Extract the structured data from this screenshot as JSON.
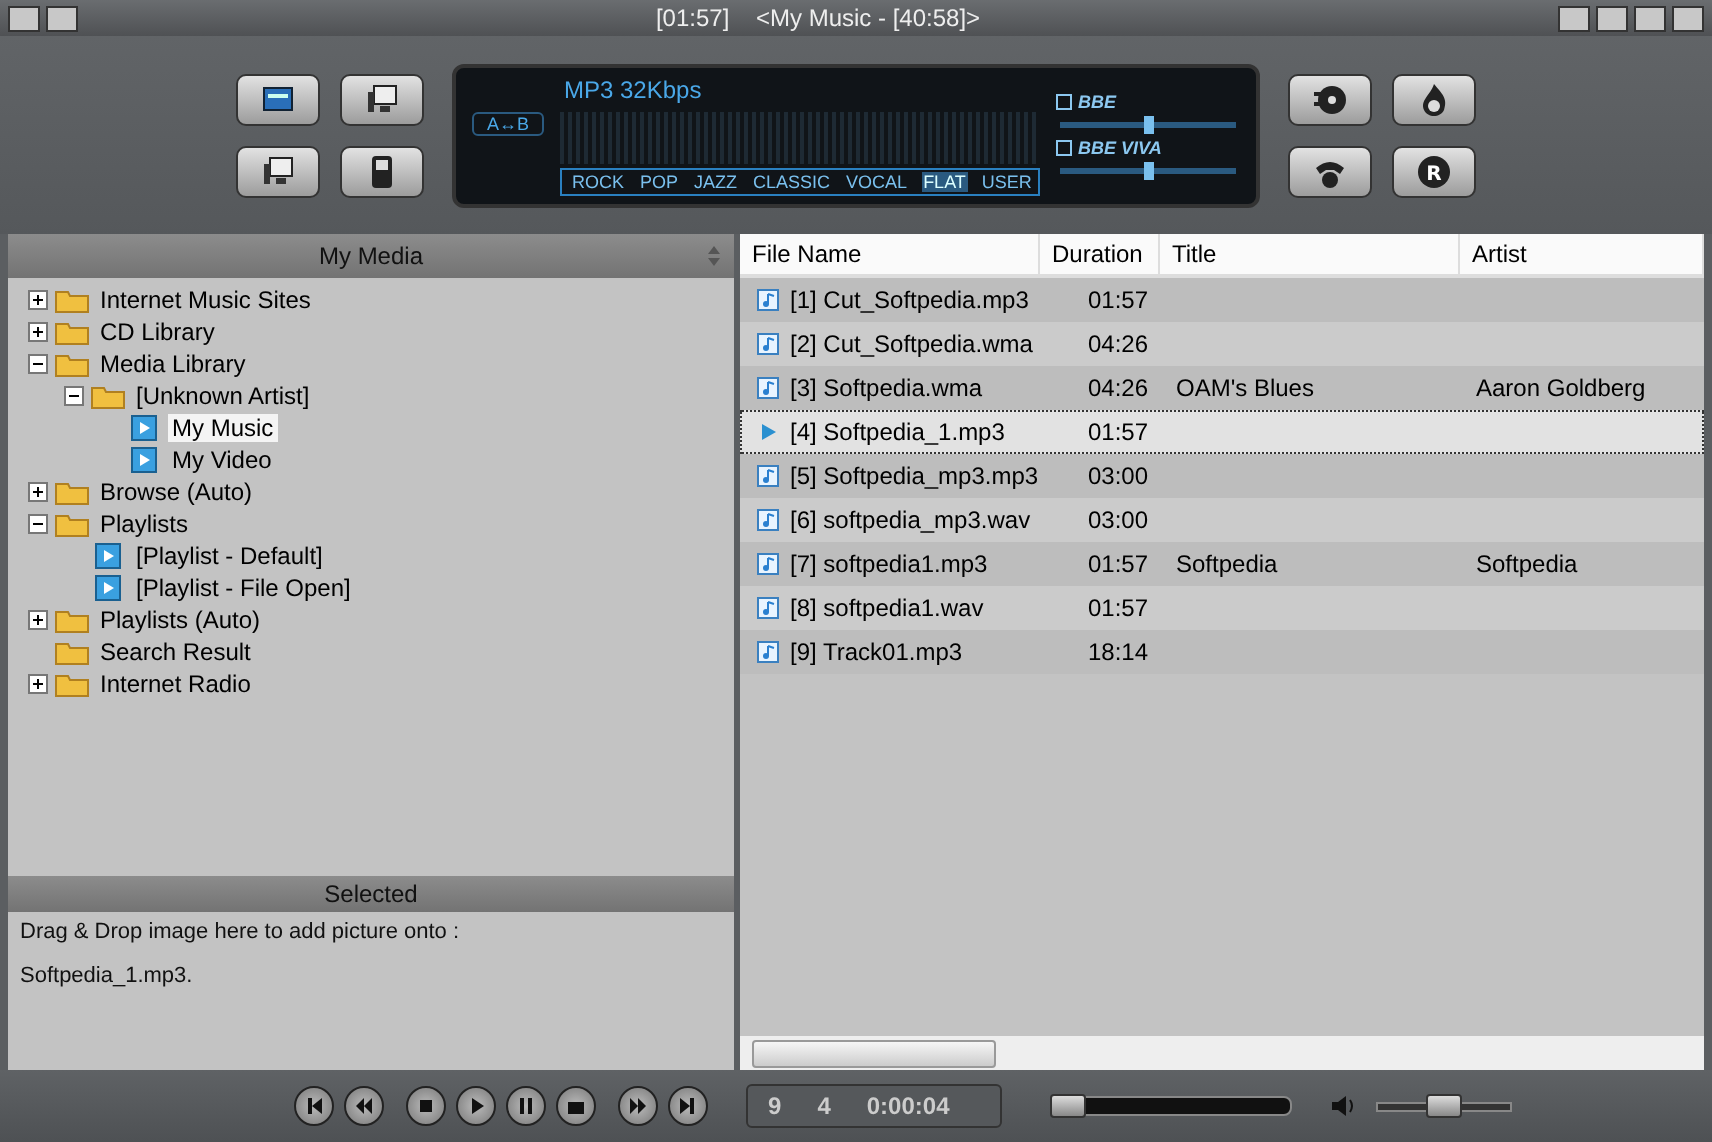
{
  "window": {
    "title": "[01:57]    <My Music - [40:58]>"
  },
  "record_button": {
    "label": "R"
  },
  "display": {
    "format": "MP3 32Kbps",
    "ab_label": "A↔B",
    "eq_presets": [
      {
        "label": "ROCK",
        "selected": false
      },
      {
        "label": "POP",
        "selected": false
      },
      {
        "label": "JAZZ",
        "selected": false
      },
      {
        "label": "CLASSIC",
        "selected": false
      },
      {
        "label": "VOCAL",
        "selected": false
      },
      {
        "label": "FLAT",
        "selected": true
      },
      {
        "label": "USER",
        "selected": false
      }
    ],
    "effects": [
      {
        "label": "BBE",
        "checked": false,
        "level": 0.5
      },
      {
        "label": "BBE VIVA",
        "checked": false,
        "level": 0.5
      }
    ]
  },
  "media_panel": {
    "title": "My Media",
    "tree": [
      {
        "label": "Internet Music Sites",
        "kind": "folder",
        "expanded": false,
        "selected": false
      },
      {
        "label": "CD Library",
        "kind": "folder",
        "expanded": false,
        "selected": false
      },
      {
        "label": "Media Library",
        "kind": "folder",
        "expanded": true,
        "selected": false,
        "children": [
          {
            "label": "[Unknown Artist]",
            "kind": "folder",
            "expanded": true,
            "selected": false,
            "children": [
              {
                "label": "My Music",
                "kind": "media",
                "selected": true
              },
              {
                "label": "My Video",
                "kind": "media",
                "selected": false
              }
            ]
          }
        ]
      },
      {
        "label": "Browse (Auto)",
        "kind": "folder",
        "expanded": false,
        "selected": false
      },
      {
        "label": "Playlists",
        "kind": "folder",
        "expanded": true,
        "selected": false,
        "children": [
          {
            "label": "[Playlist - Default]",
            "kind": "media",
            "selected": false
          },
          {
            "label": "[Playlist - File Open]",
            "kind": "media",
            "selected": false
          }
        ]
      },
      {
        "label": "Playlists (Auto)",
        "kind": "folder",
        "expanded": false,
        "selected": false
      },
      {
        "label": "Search Result",
        "kind": "folder",
        "selected": false
      },
      {
        "label": "Internet Radio",
        "kind": "folder",
        "expanded": false,
        "selected": false
      }
    ]
  },
  "selected_panel": {
    "title": "Selected",
    "lines": [
      "Drag & Drop image here to add picture onto :",
      "Softpedia_1.mp3."
    ]
  },
  "playlist": {
    "columns": [
      "File Name",
      "Duration",
      "Title",
      "Artist"
    ],
    "rows": [
      {
        "file": "[1] Cut_Softpedia.mp3",
        "duration": "01:57",
        "selected": false
      },
      {
        "file": "[2] Cut_Softpedia.wma",
        "duration": "04:26",
        "selected": false
      },
      {
        "file": "[3] Softpedia.wma",
        "duration": "04:26",
        "title": "OAM's Blues",
        "artist": "Aaron Goldberg",
        "selected": false
      },
      {
        "file": "[4] Softpedia_1.mp3",
        "duration": "01:57",
        "selected": true
      },
      {
        "file": "[5] Softpedia_mp3.mp3",
        "duration": "03:00",
        "selected": false
      },
      {
        "file": "[6] softpedia_mp3.wav",
        "duration": "03:00",
        "selected": false
      },
      {
        "file": "[7] softpedia1.mp3",
        "duration": "01:57",
        "title": "Softpedia",
        "artist": "Softpedia",
        "selected": false
      },
      {
        "file": "[8] softpedia1.wav",
        "duration": "01:57",
        "selected": false
      },
      {
        "file": "[9] Track01.mp3",
        "duration": "18:14",
        "selected": false
      }
    ]
  },
  "status": {
    "total": "9",
    "current": "4",
    "time": "0:00:04",
    "seek": {
      "level": 0.05
    },
    "volume": {
      "level": 0.48
    }
  }
}
